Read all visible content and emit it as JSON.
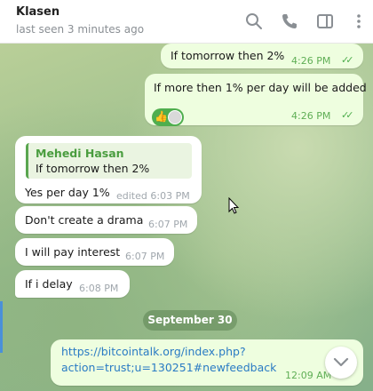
{
  "header": {
    "title": "Klasen",
    "status": "last seen 3 minutes ago",
    "icons": [
      "search-icon",
      "phone-icon",
      "sidebar-toggle-icon",
      "more-icon"
    ]
  },
  "colors": {
    "incoming_bubble": "#ffffff",
    "outgoing_bubble": "#eefedf",
    "accent_green": "#4fae4e",
    "link": "#2a7bc4"
  },
  "messages": [
    {
      "direction": "out",
      "text": "If tomorrow then 2%",
      "time": "4:26 PM",
      "read": true
    },
    {
      "direction": "out",
      "text": "If more then 1% per day will be added",
      "time": "4:26 PM",
      "read": true,
      "reaction": "👍"
    },
    {
      "direction": "in",
      "reply_to": {
        "name": "Mehedi Hasan",
        "text": "If tomorrow then 2%"
      },
      "text": "Yes per day 1%",
      "time": "edited 6:03 PM"
    },
    {
      "direction": "in",
      "text": "Don't create a drama",
      "time": "6:07 PM"
    },
    {
      "direction": "in",
      "text": "I will pay interest",
      "time": "6:07 PM"
    },
    {
      "direction": "in",
      "text": "If i delay",
      "time": "6:08 PM"
    }
  ],
  "date_separator": "September 30",
  "link_message": {
    "line1": "https://bitcointalk.org/index.php?",
    "line2": "action=trust;u=130251#newfeedback",
    "time": "12:09 AM"
  },
  "ticks": "✓✓",
  "scroll_button_icon": "chevron-down-icon"
}
